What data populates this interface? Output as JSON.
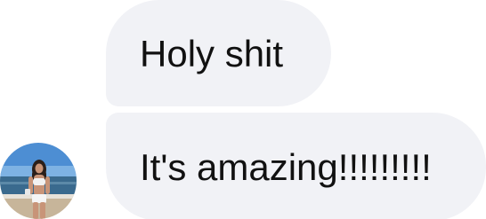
{
  "conversation": {
    "messages": [
      {
        "text": "Holy shit"
      },
      {
        "text": "It's amazing!!!!!!!!!"
      }
    ],
    "sender": {
      "avatar_icon": "profile-photo-avatar"
    }
  },
  "colors": {
    "bubble_background": "#f1f2f6",
    "text": "#111111",
    "background": "#ffffff"
  }
}
